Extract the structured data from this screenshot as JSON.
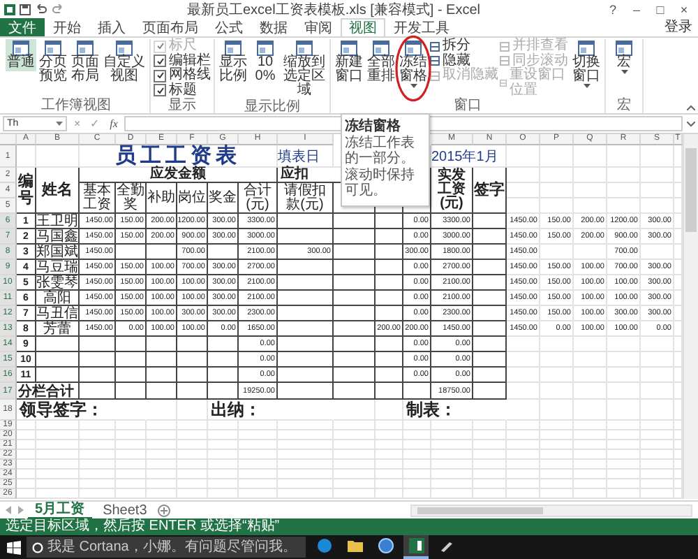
{
  "window": {
    "title": "最新员工excel工资表模板.xls [兼容模式] - Excel",
    "controls": [
      "?",
      "–",
      "□",
      "×"
    ]
  },
  "ribbon_tabs": [
    {
      "label": "文件",
      "kind": "file",
      "selected": false
    },
    {
      "label": "开始",
      "kind": "tab",
      "selected": false
    },
    {
      "label": "插入",
      "kind": "tab",
      "selected": false
    },
    {
      "label": "页面布局",
      "kind": "tab",
      "selected": false
    },
    {
      "label": "公式",
      "kind": "tab",
      "selected": false
    },
    {
      "label": "数据",
      "kind": "tab",
      "selected": false
    },
    {
      "label": "审阅",
      "kind": "tab",
      "selected": false
    },
    {
      "label": "视图",
      "kind": "tab",
      "selected": true
    },
    {
      "label": "开发工具",
      "kind": "tab",
      "selected": false
    }
  ],
  "account": "登录",
  "ribbon_groups": [
    {
      "label": "工作簿视图",
      "items": [
        {
          "kind": "large",
          "label": "普通",
          "selected": true,
          "dropdown": false,
          "circled": false
        },
        {
          "kind": "large",
          "label": "分页预览",
          "selected": false,
          "dropdown": false,
          "circled": false
        },
        {
          "kind": "large",
          "label": "页面布局",
          "selected": false,
          "dropdown": false,
          "circled": false
        },
        {
          "kind": "large",
          "label": "自定义视图",
          "selected": false,
          "dropdown": false,
          "circled": false
        }
      ]
    },
    {
      "label": "显示",
      "items": [
        {
          "kind": "checks",
          "entries": [
            {
              "label": "标尺",
              "checked": true,
              "disabled": true
            },
            {
              "label": "编辑栏",
              "checked": true,
              "disabled": false
            },
            {
              "label": "网格线",
              "checked": true,
              "disabled": false
            },
            {
              "label": "标题",
              "checked": true,
              "disabled": false
            }
          ]
        }
      ]
    },
    {
      "label": "显示比例",
      "items": [
        {
          "kind": "large",
          "label": "显示比例",
          "dropdown": false,
          "circled": false
        },
        {
          "kind": "large",
          "label": "100%",
          "dropdown": false,
          "circled": false
        },
        {
          "kind": "large",
          "label": "缩放到选定区域",
          "dropdown": false,
          "circled": false
        }
      ]
    },
    {
      "label": "窗口",
      "items": [
        {
          "kind": "large",
          "label": "新建窗口",
          "dropdown": false,
          "circled": false
        },
        {
          "kind": "large",
          "label": "全部重排",
          "dropdown": false,
          "circled": false
        },
        {
          "kind": "large",
          "label": "冻结窗格",
          "dropdown": true,
          "circled": true
        },
        {
          "kind": "smalls",
          "entries": [
            {
              "label": "拆分",
              "disabled": false
            },
            {
              "label": "隐藏",
              "disabled": false
            },
            {
              "label": "取消隐藏",
              "disabled": true
            }
          ]
        },
        {
          "kind": "smalls",
          "entries": [
            {
              "label": "并排查看",
              "disabled": true
            },
            {
              "label": "同步滚动",
              "disabled": true
            },
            {
              "label": "重设窗口位置",
              "disabled": true
            }
          ]
        },
        {
          "kind": "large",
          "label": "切换窗口",
          "dropdown": true,
          "circled": false
        }
      ]
    },
    {
      "label": "宏",
      "items": [
        {
          "kind": "large",
          "label": "宏",
          "dropdown": true,
          "circled": false
        }
      ]
    }
  ],
  "tooltip": {
    "title": "冻结窗格",
    "paragraphs": [
      "冻结工作表的一部分。",
      "滚动时保持可见。"
    ]
  },
  "formula_bar": {
    "name_box": "Th",
    "buttons": [
      "×",
      "✓",
      "fx"
    ]
  },
  "sheet": {
    "columns": [
      "A",
      "B",
      "C",
      "D",
      "E",
      "F",
      "G",
      "H",
      "I",
      null,
      null,
      null,
      "M",
      "N",
      "O",
      "P",
      "Q",
      "R",
      "S",
      "T"
    ],
    "title_row": {
      "row": "1",
      "title": "员工工资表",
      "date_label": "填表日",
      "date": "2015年1月"
    },
    "header_rows": [
      "2",
      "4",
      "5"
    ],
    "group_headers": [
      "应发金额",
      "应扣"
    ],
    "fixed_headers": {
      "number": "编号",
      "name": "姓名",
      "net": "实发工资(元)",
      "signature": "签字"
    },
    "sub_headers": [
      "基本工资",
      "全勤奖",
      "补助",
      "岗位",
      "奖金",
      "合计(元)",
      "请假扣款(元)"
    ],
    "rows": [
      {
        "row": "6",
        "cells": [
          "1",
          "王卫明",
          "1450.00",
          "150.00",
          "200.00",
          "1200.00",
          "300.00",
          "3300.00",
          null,
          null,
          null,
          "0.00",
          "3300.00",
          null,
          "1450.00",
          "150.00",
          "200.00",
          "1200.00",
          "300.00",
          null
        ]
      },
      {
        "row": "7",
        "cells": [
          "2",
          "马国鑫",
          "1450.00",
          "150.00",
          "200.00",
          "900.00",
          "300.00",
          "3000.00",
          null,
          null,
          null,
          "0.00",
          "3000.00",
          null,
          "1450.00",
          "150.00",
          "200.00",
          "900.00",
          "300.00",
          null
        ]
      },
      {
        "row": "8",
        "cells": [
          "3",
          "郑国斌",
          "1450.00",
          null,
          null,
          "700.00",
          null,
          "2100.00",
          "300.00",
          null,
          null,
          "300.00",
          "1800.00",
          null,
          "1450.00",
          null,
          null,
          "700.00",
          null,
          null
        ]
      },
      {
        "row": "9",
        "cells": [
          "4",
          "马豆瑞",
          "1450.00",
          "150.00",
          "100.00",
          "700.00",
          "300.00",
          "2700.00",
          null,
          null,
          null,
          "0.00",
          "2700.00",
          null,
          "1450.00",
          "150.00",
          "100.00",
          "700.00",
          "300.00",
          null
        ]
      },
      {
        "row": "10",
        "cells": [
          "5",
          "张雯琴",
          "1450.00",
          "150.00",
          "100.00",
          "100.00",
          "300.00",
          "2100.00",
          null,
          null,
          null,
          "0.00",
          "2100.00",
          null,
          "1450.00",
          "150.00",
          "100.00",
          "100.00",
          "300.00",
          null
        ]
      },
      {
        "row": "11",
        "cells": [
          "6",
          "高阳",
          "1450.00",
          "150.00",
          "100.00",
          "100.00",
          "300.00",
          "2100.00",
          null,
          null,
          null,
          "0.00",
          "2100.00",
          null,
          "1450.00",
          "150.00",
          "100.00",
          "100.00",
          "300.00",
          null
        ]
      },
      {
        "row": "12",
        "cells": [
          "7",
          "马丑信",
          "1450.00",
          "150.00",
          "100.00",
          "300.00",
          "300.00",
          "2300.00",
          null,
          null,
          null,
          "0.00",
          "2300.00",
          null,
          "1450.00",
          "150.00",
          "100.00",
          "300.00",
          "300.00",
          null
        ]
      },
      {
        "row": "13",
        "cells": [
          "8",
          "芳蕾",
          "1450.00",
          "0.00",
          "100.00",
          "100.00",
          "0.00",
          "1650.00",
          null,
          null,
          "200.00",
          "200.00",
          "1450.00",
          null,
          "1450.00",
          "0.00",
          "100.00",
          "100.00",
          "0.00",
          null
        ]
      },
      {
        "row": "14",
        "cells": [
          "9",
          null,
          null,
          null,
          null,
          null,
          null,
          "0.00",
          null,
          null,
          null,
          "0.00",
          "0.00",
          null,
          null,
          null,
          null,
          null,
          null,
          null
        ]
      },
      {
        "row": "15",
        "cells": [
          "10",
          null,
          null,
          null,
          null,
          null,
          null,
          "0.00",
          null,
          null,
          null,
          "0.00",
          "0.00",
          null,
          null,
          null,
          null,
          null,
          null,
          null
        ]
      },
      {
        "row": "16",
        "cells": [
          "11",
          null,
          null,
          null,
          null,
          null,
          null,
          "0.00",
          null,
          null,
          null,
          "0.00",
          "0.00",
          null,
          null,
          null,
          null,
          null,
          null,
          null
        ]
      }
    ],
    "total_row": {
      "row": "17",
      "label": "分栏合计",
      "gross": "19250.00",
      "net": "18750.00"
    },
    "sign_row": {
      "row": "18",
      "labels": [
        "领导签字：",
        "出纳：",
        "制表："
      ]
    },
    "empty_rows": [
      "19",
      "20",
      "21",
      "22",
      "23",
      "24",
      "25",
      "26"
    ]
  },
  "sheet_tabs": [
    {
      "label": "5月工资",
      "selected": true
    },
    {
      "label": "Sheet3",
      "selected": false
    }
  ],
  "status_bar": {
    "message": "选定目标区域，然后按 ENTER 或选择“粘贴”"
  },
  "taskbar": {
    "search_placeholder": "我是 Cortana，小娜。有问题尽管问我。",
    "apps": [
      {
        "active": false
      },
      {
        "active": false
      },
      {
        "active": false
      },
      {
        "active": true
      },
      {
        "active": false
      }
    ]
  }
}
